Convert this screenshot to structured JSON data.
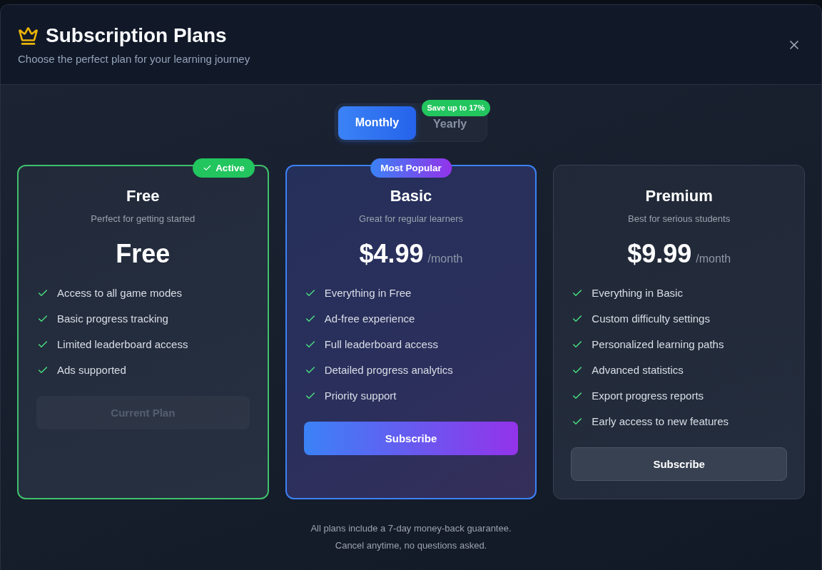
{
  "dialog": {
    "title": "Subscription Plans",
    "subtitle": "Choose the perfect plan for your learning journey"
  },
  "billing_toggle": {
    "options": [
      {
        "label": "Monthly",
        "selected": true
      },
      {
        "label": "Yearly",
        "selected": false,
        "badge": "Save up to 17%"
      }
    ]
  },
  "plans": [
    {
      "kind": "current",
      "badge": {
        "kind": "active",
        "label": "Active"
      },
      "name": "Free",
      "tagline": "Perfect for getting started",
      "price": "Free",
      "features": [
        "Access to all game modes",
        "Basic progress tracking",
        "Limited leaderboard access",
        "Ads supported"
      ],
      "button": {
        "kind": "muted",
        "label": "Current Plan",
        "disabled": true
      }
    },
    {
      "kind": "featured",
      "badge": {
        "kind": "popular",
        "label": "Most Popular"
      },
      "name": "Basic",
      "tagline": "Great for regular learners",
      "price": "$4.99",
      "period": "/month",
      "features": [
        "Everything in Free",
        "Ad-free experience",
        "Full leaderboard access",
        "Detailed progress analytics",
        "Priority support"
      ],
      "button": {
        "kind": "gradient",
        "label": "Subscribe",
        "disabled": false
      }
    },
    {
      "kind": "standard",
      "name": "Premium",
      "tagline": "Best for serious students",
      "price": "$9.99",
      "period": "/month",
      "features": [
        "Everything in Basic",
        "Custom difficulty settings",
        "Personalized learning paths",
        "Advanced statistics",
        "Export progress reports",
        "Early access to new features"
      ],
      "button": {
        "kind": "secondary",
        "label": "Subscribe",
        "disabled": false
      }
    }
  ],
  "footer": [
    "All plans include a 7-day money-back guarantee.",
    "Cancel anytime, no questions asked."
  ]
}
